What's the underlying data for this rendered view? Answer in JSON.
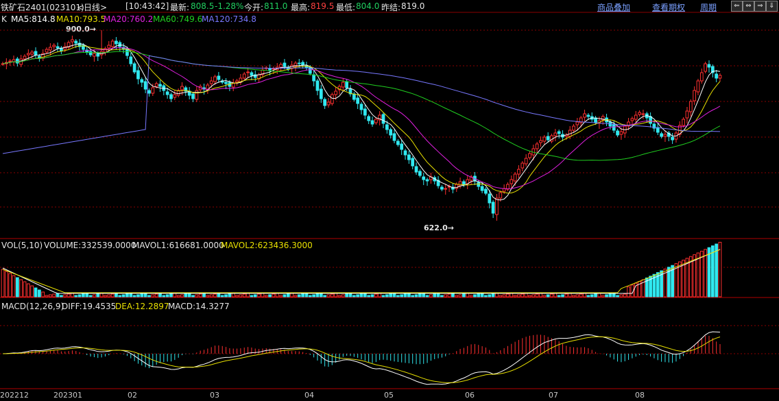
{
  "header": {
    "instrument": "铁矿石2401(023101)",
    "period_label": "<日线>",
    "time": "[10:43:42]",
    "latest_label": "最新:",
    "latest_value": "808.5",
    "change_pct": "-1.28%",
    "open_label": "今开:",
    "open_value": "811.0",
    "high_label": "最高:",
    "high_value": "819.5",
    "low_label": "最低:",
    "low_value": "804.0",
    "prev_close_label": "昨结:",
    "prev_close_value": "819.0"
  },
  "toolbar": {
    "overlay": "商品叠加",
    "futures_period": "查看期权",
    "period": "周期",
    "nav_buttons": [
      "⇐",
      "⇔",
      "⇒",
      "⇓"
    ]
  },
  "price_panel": {
    "k_label": "K",
    "ma5": "MA5:814.8",
    "ma10": "MA10:793.5",
    "ma20": "MA20:760.2",
    "ma60": "MA60:749.6",
    "ma120": "MA120:734.8",
    "high_marker": "900.0→",
    "low_marker": "622.0→"
  },
  "volume_panel": {
    "title": "VOL(5,10)",
    "volume": "VOLUME:332539.0000",
    "mavol1": "MAVOL1:616681.0000",
    "mavol2": "MAVOL2:623436.3000"
  },
  "macd_panel": {
    "title": "MACD(12,26,9)",
    "diff": "DIFF:19.4535",
    "dea": "DEA:12.2897",
    "macd": "MACD:14.3277"
  },
  "x_axis": [
    "202212",
    "202301",
    "02",
    "03",
    "04",
    "05",
    "06",
    "07",
    "08"
  ],
  "colors": {
    "up": "#ff3030",
    "down": "#30e8f0",
    "ma5": "#ffffff",
    "ma10": "#e8e000",
    "ma20": "#e020e0",
    "ma60": "#20d020",
    "ma120": "#7878ff",
    "grid": "#8b0000"
  },
  "chart_data": {
    "type": "candlestick",
    "series": [
      {
        "name": "MA5",
        "values": [
          814.8
        ]
      },
      {
        "name": "MA10",
        "values": [
          793.5
        ]
      },
      {
        "name": "MA20",
        "values": [
          760.2
        ]
      },
      {
        "name": "MA60",
        "values": [
          749.6
        ]
      },
      {
        "name": "MA120",
        "values": [
          734.8
        ]
      }
    ],
    "price_high": 900.0,
    "price_low": 622.0,
    "x": [
      "202212",
      "202301",
      "02",
      "03",
      "04",
      "05",
      "06",
      "07",
      "08"
    ],
    "closes": [
      851,
      853,
      855,
      857,
      852,
      858,
      862,
      866,
      868,
      864,
      859,
      866,
      872,
      875,
      878,
      874,
      870,
      876,
      882,
      886,
      881,
      876,
      872,
      868,
      864,
      866,
      862,
      869,
      873,
      878,
      884,
      880,
      876,
      872,
      863,
      851,
      839,
      829,
      824,
      814,
      808,
      816,
      822,
      818,
      812,
      806,
      800,
      806,
      812,
      818,
      811,
      805,
      800,
      812,
      818,
      814,
      820,
      826,
      832,
      828,
      824,
      822,
      818,
      823,
      826,
      830,
      836,
      839,
      834,
      831,
      835,
      842,
      845,
      842,
      844,
      846,
      850,
      847,
      843,
      849,
      852,
      851,
      849,
      845,
      837,
      826,
      812,
      800,
      790,
      795,
      806,
      811,
      818,
      824,
      816,
      807,
      799,
      793,
      784,
      776,
      768,
      763,
      770,
      776,
      764,
      755,
      747,
      739,
      733,
      726,
      718,
      711,
      702,
      693,
      688,
      682,
      680,
      686,
      680,
      673,
      668,
      669,
      672,
      668,
      675,
      679,
      674,
      682,
      686,
      680,
      672,
      666,
      662,
      648,
      633,
      655,
      663,
      669,
      675,
      682,
      690,
      697,
      706,
      713,
      720,
      727,
      734,
      739,
      744,
      740,
      746,
      750,
      749,
      744,
      747,
      754,
      760,
      766,
      772,
      778,
      774,
      770,
      765,
      768,
      774,
      766,
      760,
      754,
      747,
      752,
      760,
      766,
      771,
      776,
      780,
      778,
      772,
      764,
      757,
      751,
      745,
      748,
      745,
      740,
      750,
      761,
      770,
      782,
      796,
      812,
      826,
      838,
      851,
      846,
      838,
      830,
      834
    ]
  }
}
